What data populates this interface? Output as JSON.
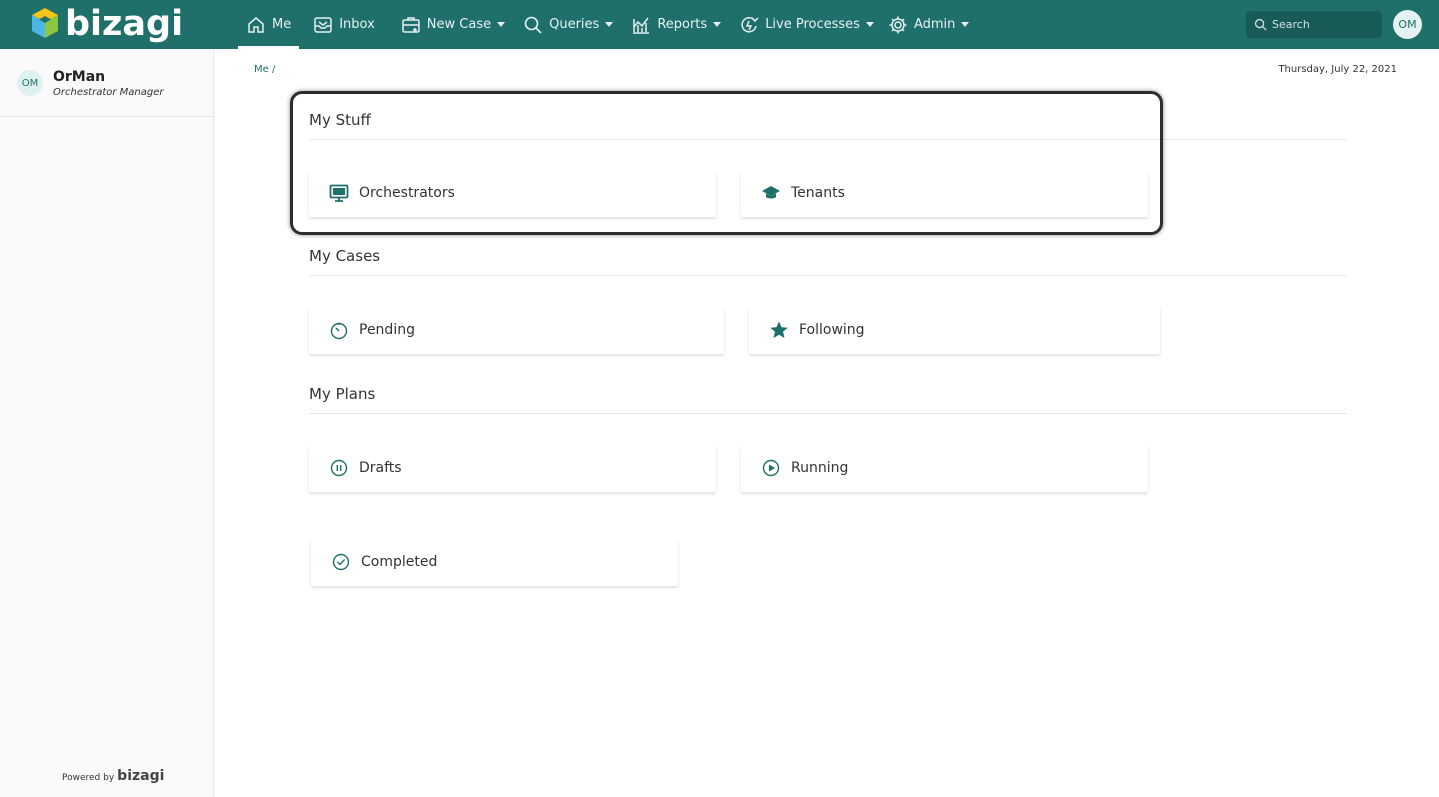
{
  "app": {
    "brand": "bizagi"
  },
  "nav": {
    "items": [
      {
        "key": "me",
        "label": "Me"
      },
      {
        "key": "inbox",
        "label": "Inbox"
      },
      {
        "key": "new_case",
        "label": "New Case"
      },
      {
        "key": "queries",
        "label": "Queries"
      },
      {
        "key": "reports",
        "label": "Reports"
      },
      {
        "key": "live_processes",
        "label": "Live Processes"
      },
      {
        "key": "admin",
        "label": "Admin"
      }
    ],
    "active": "Me"
  },
  "search": {
    "placeholder": "Search"
  },
  "user": {
    "initials": "OM",
    "name": "OrMan",
    "role": "Orchestrator Manager"
  },
  "breadcrumb": "Me /",
  "date": "Thursday, July 22, 2021",
  "sections": {
    "my_stuff": {
      "title": "My Stuff",
      "cards": [
        "Orchestrators",
        "Tenants"
      ]
    },
    "my_cases": {
      "title": "My Cases",
      "cards": [
        "Pending",
        "Following"
      ]
    },
    "my_plans": {
      "title": "My Plans",
      "cards": [
        "Drafts",
        "Running",
        "Completed"
      ]
    }
  },
  "footer": {
    "powered_by": "Powered by",
    "brand": "bizagi"
  },
  "colors": {
    "topbar": "#1f6f6a",
    "accent": "#1f6f6a",
    "highlight": "#2d2d2d"
  }
}
